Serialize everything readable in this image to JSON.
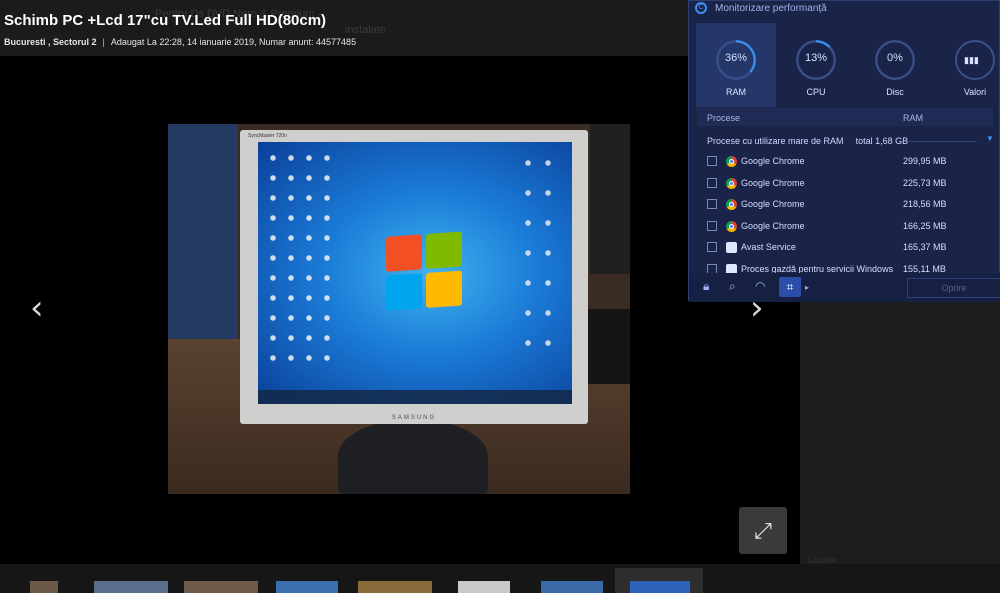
{
  "listing": {
    "title": "Schimb PC +Lcd 17\"cu TV.Led Full HD(80cm)",
    "location": "Bucuresti , Sectorul 2",
    "separator": "|",
    "added": "Adaugat La 22:28, 14 ianuarie 2019, Numar anunt: 44577485",
    "ghost_text_1": "Pentru Ds  DVD Nero & Premium -",
    "ghost_text_2": "instalate"
  },
  "photo": {
    "monitor_brand_top": "SyncMaster 720n",
    "monitor_brand_bottom": "SAMSUNG"
  },
  "viewer": {
    "prev_icon": "chevron-left-icon",
    "next_icon": "chevron-right-icon",
    "fullscreen_icon": "expand-icon",
    "prev_glyph": "‹",
    "next_glyph": "›",
    "fullscreen_glyph": "⤢"
  },
  "sidebar": {
    "faded_text": "Locatie"
  },
  "perf_monitor": {
    "title": "Monitorizare performanță",
    "logo": "C",
    "tabs": [
      {
        "label": "RAM",
        "value": "36%",
        "percent": 36
      },
      {
        "label": "CPU",
        "value": "13%",
        "percent": 13
      },
      {
        "label": "Disc",
        "value": "0%",
        "percent": 0
      },
      {
        "label": "Valori",
        "icon": "bar-chart-icon",
        "glyph": "▮▮▮"
      }
    ],
    "columns": {
      "processes": "Procese",
      "ram": "RAM"
    },
    "summary_label": "Procese cu utilizare mare de RAM",
    "summary_total": "total 1,68 GB",
    "processes": [
      {
        "name": "Google Chrome",
        "ram": "299,95 MB",
        "icon": "chrome-icon"
      },
      {
        "name": "Google Chrome",
        "ram": "225,73 MB",
        "icon": "chrome-icon"
      },
      {
        "name": "Google Chrome",
        "ram": "218,56 MB",
        "icon": "chrome-icon"
      },
      {
        "name": "Google Chrome",
        "ram": "166,25 MB",
        "icon": "chrome-icon"
      },
      {
        "name": "Avast Service",
        "ram": "165,37 MB",
        "icon": "avast-icon"
      },
      {
        "name": "Proces gazdă pentru servicii Windows",
        "ram": "155,11 MB",
        "icon": "windows-service-icon"
      }
    ],
    "toolbar": {
      "icons": [
        "lock-icon",
        "search-icon",
        "gauge-icon",
        "crop-icon"
      ],
      "stop_label": "Oprire"
    },
    "colors": {
      "accent": "#3c8ff0",
      "background": "#1a2448"
    }
  }
}
